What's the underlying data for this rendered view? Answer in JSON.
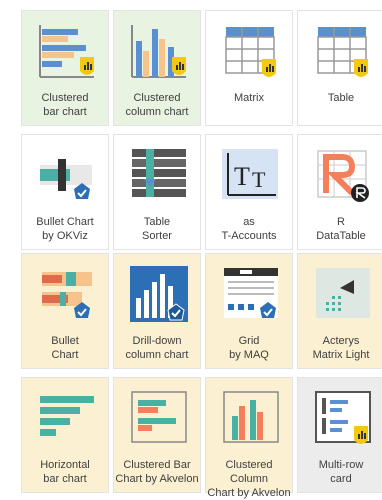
{
  "tiles": [
    {
      "label": "Clustered\nbar chart",
      "icon": "clustered-bar-chart-icon"
    },
    {
      "label": "Clustered\ncolumn chart",
      "icon": "clustered-column-chart-icon"
    },
    {
      "label": "Matrix",
      "icon": "matrix-icon"
    },
    {
      "label": "Table",
      "icon": "table-icon"
    },
    {
      "label": "Bullet Chart\nby OKViz",
      "icon": "bullet-chart-icon"
    },
    {
      "label": "Table\nSorter",
      "icon": "table-sorter-icon"
    },
    {
      "label": "as\nT-Accounts",
      "icon": "t-accounts-icon"
    },
    {
      "label": "R\nDataTable",
      "icon": "r-datatable-icon"
    },
    {
      "label": "Bullet\nChart",
      "icon": "bullet-chart-icon"
    },
    {
      "label": "Drill-down\ncolumn chart",
      "icon": "drill-down-column-chart-icon"
    },
    {
      "label": "Grid\nby MAQ",
      "icon": "grid-icon"
    },
    {
      "label": "Acterys\nMatrix Light",
      "icon": "acterys-matrix-icon"
    },
    {
      "label": "Horizontal\nbar chart",
      "icon": "horizontal-bar-chart-icon"
    },
    {
      "label": "Clustered Bar\nChart by Akvelon",
      "icon": "clustered-bar-chart-icon"
    },
    {
      "label": "Clustered Column\nChart by Akvelon",
      "icon": "clustered-column-chart-icon"
    },
    {
      "label": "Multi-row\ncard",
      "icon": "multi-row-card-icon"
    }
  ],
  "icon_glyphs": {
    "t_accounts": "T"
  },
  "colors": {
    "tile_green": "#e9f3e2",
    "tile_yellow": "#fbf0d1",
    "tile_gray": "#ececec",
    "badge_yellow": "#f2c811",
    "badge_blue": "#2c6fb5",
    "accent_blue": "#5a8fd1",
    "accent_teal": "#4ab0a3"
  }
}
